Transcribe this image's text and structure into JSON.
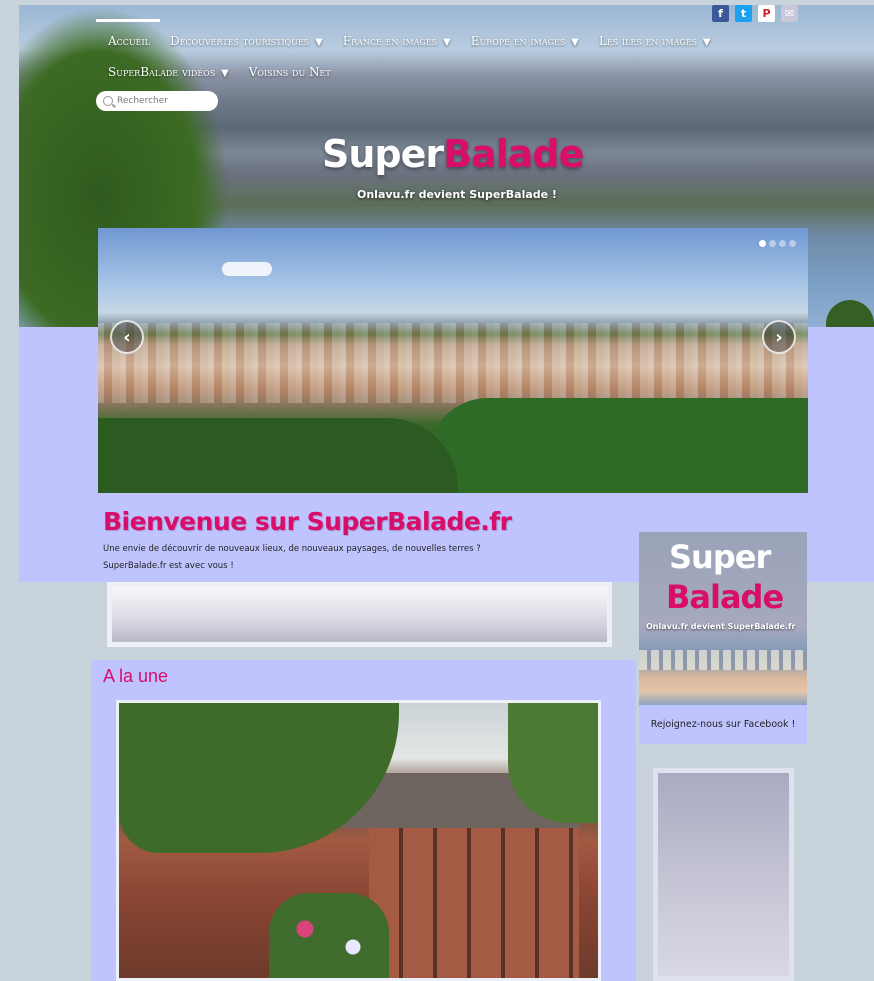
{
  "nav": {
    "row1": [
      {
        "label": "Accueil",
        "arrow": ""
      },
      {
        "label": "Découvertes touristiques",
        "arrow": "▼"
      },
      {
        "label": "France en images",
        "arrow": "▼"
      },
      {
        "label": "Europe en images",
        "arrow": "▼"
      },
      {
        "label": "Les îles en images",
        "arrow": "▼"
      }
    ],
    "row2": [
      {
        "label": "SuperBalade vidéos",
        "arrow": "▼"
      },
      {
        "label": "Voisins du Net",
        "arrow": ""
      }
    ]
  },
  "social": {
    "facebook": "f",
    "twitter": "t",
    "pinterest": "P",
    "email": "✉"
  },
  "search": {
    "placeholder": "Rechercher"
  },
  "brand": {
    "part1": "Super",
    "part2": "Balade",
    "tagline": "Onlavu.fr devient SuperBalade !"
  },
  "slider": {
    "prev": "‹",
    "next": "›",
    "dot_count": 4,
    "active_dot": 1
  },
  "welcome": {
    "title": "Bienvenue sur SuperBalade.fr",
    "line1": "Une envie de découvrir de nouveaux lieux, de nouveaux paysages, de nouvelles terres ?",
    "line2": "SuperBalade.fr est avec vous !"
  },
  "une": {
    "title": "A la une"
  },
  "sidebar": {
    "fb_title1": "Super",
    "fb_title2": "Balade",
    "fb_tagline": "Onlavu.fr devient SuperBalade.fr",
    "fb_caption": "Rejoignez-nous sur Facebook !"
  },
  "colors": {
    "accent": "#d90d6a",
    "lavender": "#bfc4ff",
    "page_bg": "#c9d3dc"
  }
}
